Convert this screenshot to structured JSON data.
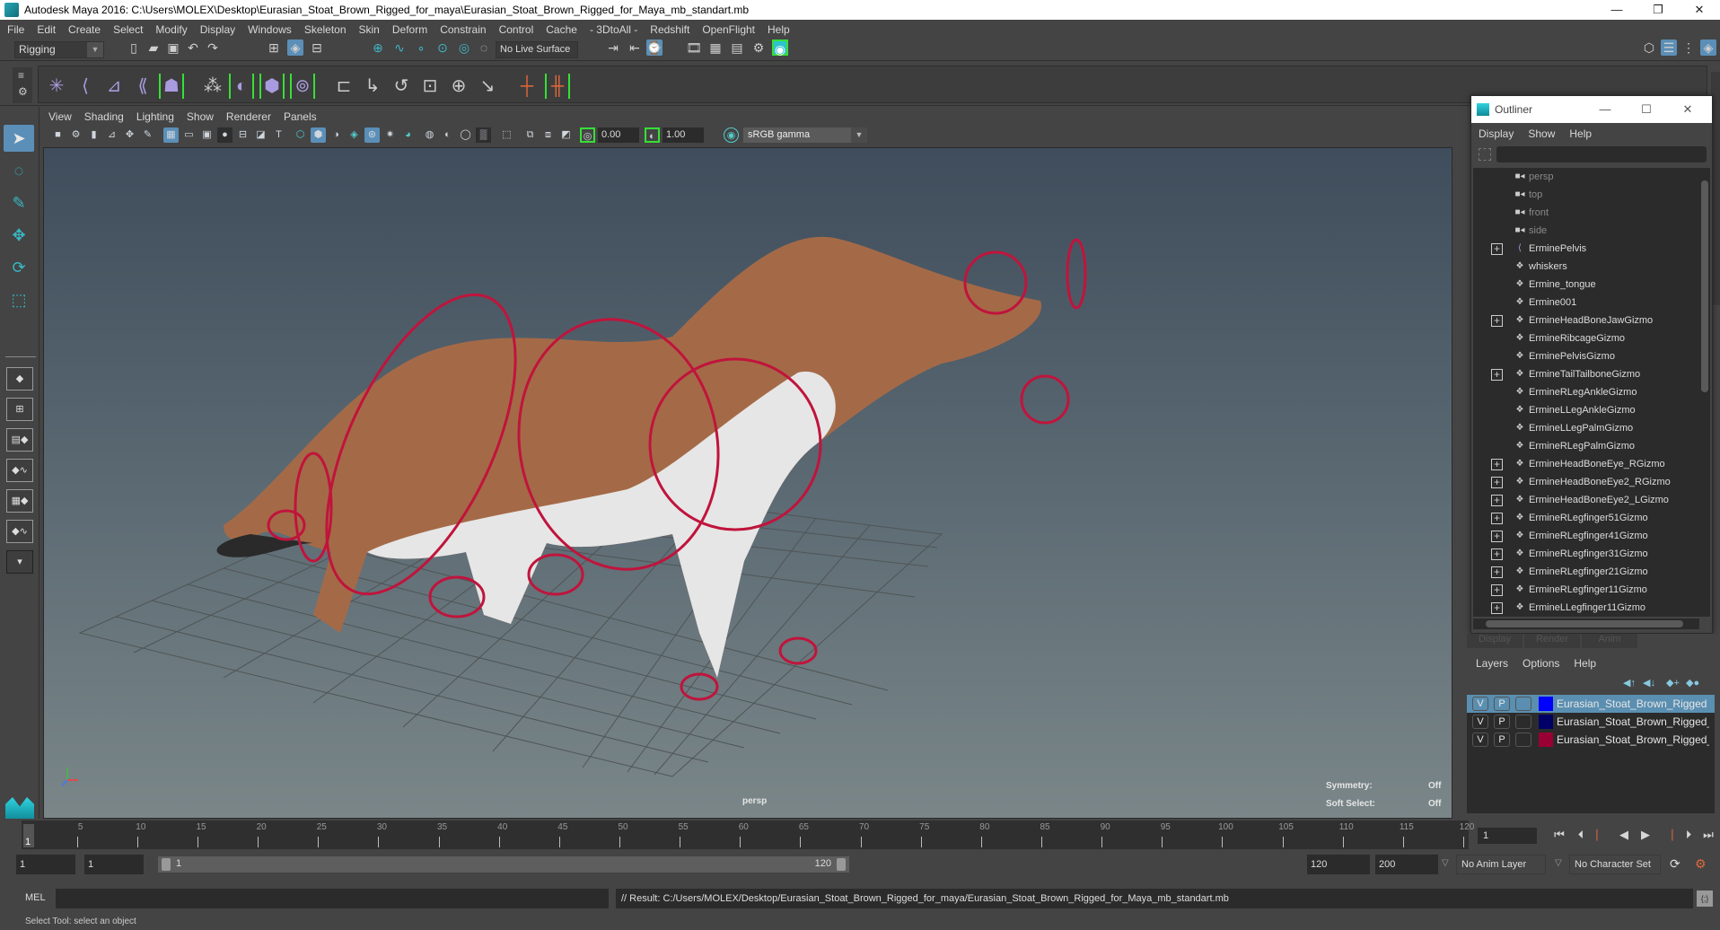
{
  "window": {
    "title": "Autodesk Maya 2016: C:\\Users\\MOLEX\\Desktop\\Eurasian_Stoat_Brown_Rigged_for_maya\\Eurasian_Stoat_Brown_Rigged_for_Maya_mb_standart.mb",
    "minimize": "—",
    "restore": "❐",
    "close": "✕"
  },
  "menubar": [
    "File",
    "Edit",
    "Create",
    "Select",
    "Modify",
    "Display",
    "Windows",
    "Skeleton",
    "Skin",
    "Deform",
    "Constrain",
    "Control",
    "Cache",
    "- 3DtoAll -",
    "Redshift",
    "OpenFlight",
    "Help"
  ],
  "statusline": {
    "menuset": "Rigging",
    "live_surface": "No Live Surface"
  },
  "panel": {
    "menus": [
      "View",
      "Shading",
      "Lighting",
      "Show",
      "Renderer",
      "Panels"
    ],
    "exposure": "0.00",
    "gamma": "1.00",
    "color_space": "sRGB gamma",
    "camera_label": "persp",
    "hud": {
      "symmetry_label": "Symmetry:",
      "symmetry_value": "Off",
      "soft_select_label": "Soft Select:",
      "soft_select_value": "Off"
    }
  },
  "outliner": {
    "title": "Outliner",
    "menus": [
      "Display",
      "Show",
      "Help"
    ],
    "search_value": "",
    "items": [
      {
        "label": "persp",
        "type": "camera",
        "expandable": false
      },
      {
        "label": "top",
        "type": "camera",
        "expandable": false
      },
      {
        "label": "front",
        "type": "camera",
        "expandable": false
      },
      {
        "label": "side",
        "type": "camera",
        "expandable": false
      },
      {
        "label": "ErminePelvis",
        "type": "joint",
        "expandable": true
      },
      {
        "label": "whiskers",
        "type": "mesh",
        "expandable": false
      },
      {
        "label": "Ermine_tongue",
        "type": "mesh",
        "expandable": false
      },
      {
        "label": "Ermine001",
        "type": "mesh",
        "expandable": false
      },
      {
        "label": "ErmineHeadBoneJawGizmo",
        "type": "mesh",
        "expandable": true
      },
      {
        "label": "ErmineRibcageGizmo",
        "type": "mesh",
        "expandable": false
      },
      {
        "label": "ErminePelvisGizmo",
        "type": "mesh",
        "expandable": false
      },
      {
        "label": "ErmineTailTailboneGizmo",
        "type": "mesh",
        "expandable": true
      },
      {
        "label": "ErmineRLegAnkleGizmo",
        "type": "mesh",
        "expandable": false
      },
      {
        "label": "ErmineLLegAnkleGizmo",
        "type": "mesh",
        "expandable": false
      },
      {
        "label": "ErmineLLegPalmGizmo",
        "type": "mesh",
        "expandable": false
      },
      {
        "label": "ErmineRLegPalmGizmo",
        "type": "mesh",
        "expandable": false
      },
      {
        "label": "ErmineHeadBoneEye_RGizmo",
        "type": "mesh",
        "expandable": true
      },
      {
        "label": "ErmineHeadBoneEye2_RGizmo",
        "type": "mesh",
        "expandable": true
      },
      {
        "label": "ErmineHeadBoneEye2_LGizmo",
        "type": "mesh",
        "expandable": true
      },
      {
        "label": "ErmineRLegfinger51Gizmo",
        "type": "mesh",
        "expandable": true
      },
      {
        "label": "ErmineRLegfinger41Gizmo",
        "type": "mesh",
        "expandable": true
      },
      {
        "label": "ErmineRLegfinger31Gizmo",
        "type": "mesh",
        "expandable": true
      },
      {
        "label": "ErmineRLegfinger21Gizmo",
        "type": "mesh",
        "expandable": true
      },
      {
        "label": "ErmineRLegfinger11Gizmo",
        "type": "mesh",
        "expandable": true
      },
      {
        "label": "ErmineLLegfinger11Gizmo",
        "type": "mesh",
        "expandable": true
      }
    ]
  },
  "layer_editor": {
    "tabs": [
      "Display",
      "Render",
      "Anim"
    ],
    "menus": [
      "Layers",
      "Options",
      "Help"
    ],
    "layers": [
      {
        "v": "V",
        "p": "P",
        "color": "#0000ff",
        "name": "Eurasian_Stoat_Brown_Rigged",
        "selected": true
      },
      {
        "v": "V",
        "p": "P",
        "color": "#000066",
        "name": "Eurasian_Stoat_Brown_Rigged_B",
        "selected": false
      },
      {
        "v": "V",
        "p": "P",
        "color": "#990033",
        "name": "Eurasian_Stoat_Brown_Rigged_C",
        "selected": false
      }
    ]
  },
  "timeline": {
    "start": 1,
    "end": 120,
    "major_ticks": [
      5,
      10,
      15,
      20,
      25,
      30,
      35,
      40,
      45,
      50,
      55,
      60,
      65,
      70,
      75,
      80,
      85,
      90,
      95,
      100,
      105,
      110,
      115,
      120
    ],
    "current_frame_marker": "1",
    "current_frame": "1"
  },
  "range": {
    "anim_start": "1",
    "playback_start": "1",
    "range_start_label": "1",
    "range_end_label": "120",
    "playback_end": "120",
    "anim_end": "200",
    "anim_layer": "No Anim Layer",
    "character_set": "No Character Set"
  },
  "command": {
    "language": "MEL",
    "input": "",
    "result": "// Result: C:/Users/MOLEX/Desktop/Eurasian_Stoat_Brown_Rigged_for_maya/Eurasian_Stoat_Brown_Rigged_for_Maya_mb_standart.mb"
  },
  "help_line": "Select Tool: select an object"
}
